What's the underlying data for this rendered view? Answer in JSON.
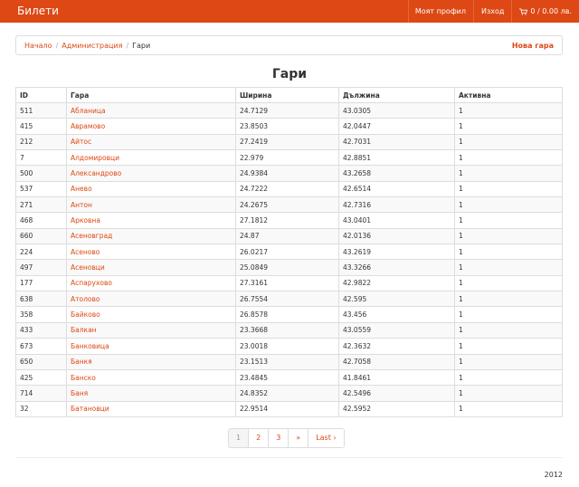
{
  "navbar": {
    "brand": "Билети",
    "profile_label": "Моят профил",
    "logout_label": "Изход",
    "cart_label": "0 / 0.00 лв."
  },
  "breadcrumb": {
    "items": [
      "Начало",
      "Администрация"
    ],
    "current": "Гари",
    "separator": "/",
    "new_button": "Нова гара"
  },
  "page": {
    "title": "Гари"
  },
  "table": {
    "headers": [
      "ID",
      "Гара",
      "Ширина",
      "Дължина",
      "Активна"
    ],
    "rows": [
      {
        "id": "511",
        "name": "Абланица",
        "lat": "24.7129",
        "lng": "43.0305",
        "active": "1"
      },
      {
        "id": "415",
        "name": "Аврамово",
        "lat": "23.8503",
        "lng": "42.0447",
        "active": "1"
      },
      {
        "id": "212",
        "name": "Айтос",
        "lat": "27.2419",
        "lng": "42.7031",
        "active": "1"
      },
      {
        "id": "7",
        "name": "Алдомировци",
        "lat": "22.979",
        "lng": "42.8851",
        "active": "1"
      },
      {
        "id": "500",
        "name": "Александрово",
        "lat": "24.9384",
        "lng": "43.2658",
        "active": "1"
      },
      {
        "id": "537",
        "name": "Анево",
        "lat": "24.7222",
        "lng": "42.6514",
        "active": "1"
      },
      {
        "id": "271",
        "name": "Антон",
        "lat": "24.2675",
        "lng": "42.7316",
        "active": "1"
      },
      {
        "id": "468",
        "name": "Арковна",
        "lat": "27.1812",
        "lng": "43.0401",
        "active": "1"
      },
      {
        "id": "660",
        "name": "Асеновград",
        "lat": "24.87",
        "lng": "42.0136",
        "active": "1"
      },
      {
        "id": "224",
        "name": "Асеново",
        "lat": "26.0217",
        "lng": "43.2619",
        "active": "1"
      },
      {
        "id": "497",
        "name": "Асеновци",
        "lat": "25.0849",
        "lng": "43.3266",
        "active": "1"
      },
      {
        "id": "177",
        "name": "Аспарухово",
        "lat": "27.3161",
        "lng": "42.9822",
        "active": "1"
      },
      {
        "id": "638",
        "name": "Атолово",
        "lat": "26.7554",
        "lng": "42.595",
        "active": "1"
      },
      {
        "id": "358",
        "name": "Байково",
        "lat": "26.8578",
        "lng": "43.456",
        "active": "1"
      },
      {
        "id": "433",
        "name": "Балкан",
        "lat": "23.3668",
        "lng": "43.0559",
        "active": "1"
      },
      {
        "id": "673",
        "name": "Банковица",
        "lat": "23.0018",
        "lng": "42.3632",
        "active": "1"
      },
      {
        "id": "650",
        "name": "Банкя",
        "lat": "23.1513",
        "lng": "42.7058",
        "active": "1"
      },
      {
        "id": "425",
        "name": "Банско",
        "lat": "23.4845",
        "lng": "41.8461",
        "active": "1"
      },
      {
        "id": "714",
        "name": "Баня",
        "lat": "24.8352",
        "lng": "42.5496",
        "active": "1"
      },
      {
        "id": "32",
        "name": "Батановци",
        "lat": "22.9514",
        "lng": "42.5952",
        "active": "1"
      }
    ]
  },
  "pagination": {
    "pages": [
      "1",
      "2",
      "3"
    ],
    "current": "1",
    "next_label": "»",
    "last_label": "Last ›"
  },
  "footer": {
    "year": "2012"
  },
  "colors": {
    "accent": "#dd4814"
  }
}
